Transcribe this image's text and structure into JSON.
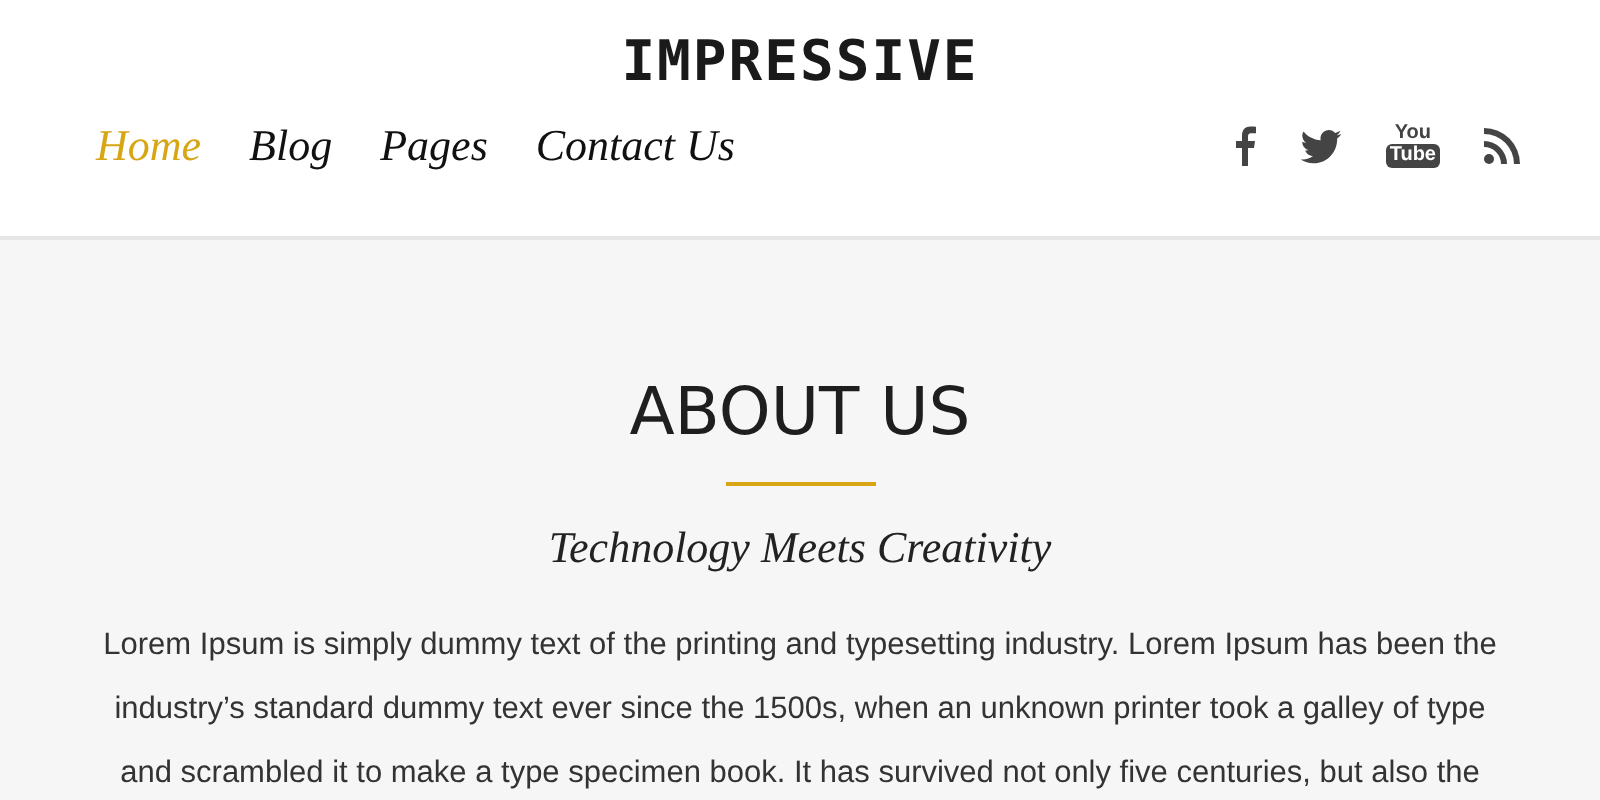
{
  "logo": "IMPRESSIVE",
  "nav": [
    {
      "label": "Home",
      "selected": true
    },
    {
      "label": "Blog",
      "selected": false
    },
    {
      "label": "Pages",
      "selected": false
    },
    {
      "label": "Contact Us",
      "selected": false
    }
  ],
  "social": [
    {
      "kind": "facebook"
    },
    {
      "kind": "twitter"
    },
    {
      "kind": "youtube",
      "label": "You",
      "label_2": "Tube"
    },
    {
      "kind": "rss"
    }
  ],
  "section": {
    "title": "ABOUT US",
    "subtitle": "Technology Meets Creativity",
    "paragraph_lines": [
      "Lorem Ipsum is simply dummy text of the printing and typesetting industry. Lorem Ipsum has been the",
      "industry’s standard dummy text ever since the 1500s, when an unknown printer took a galley of type",
      "and scrambled it to make a type specimen book. It has survived not only five centuries, but also the"
    ]
  }
}
